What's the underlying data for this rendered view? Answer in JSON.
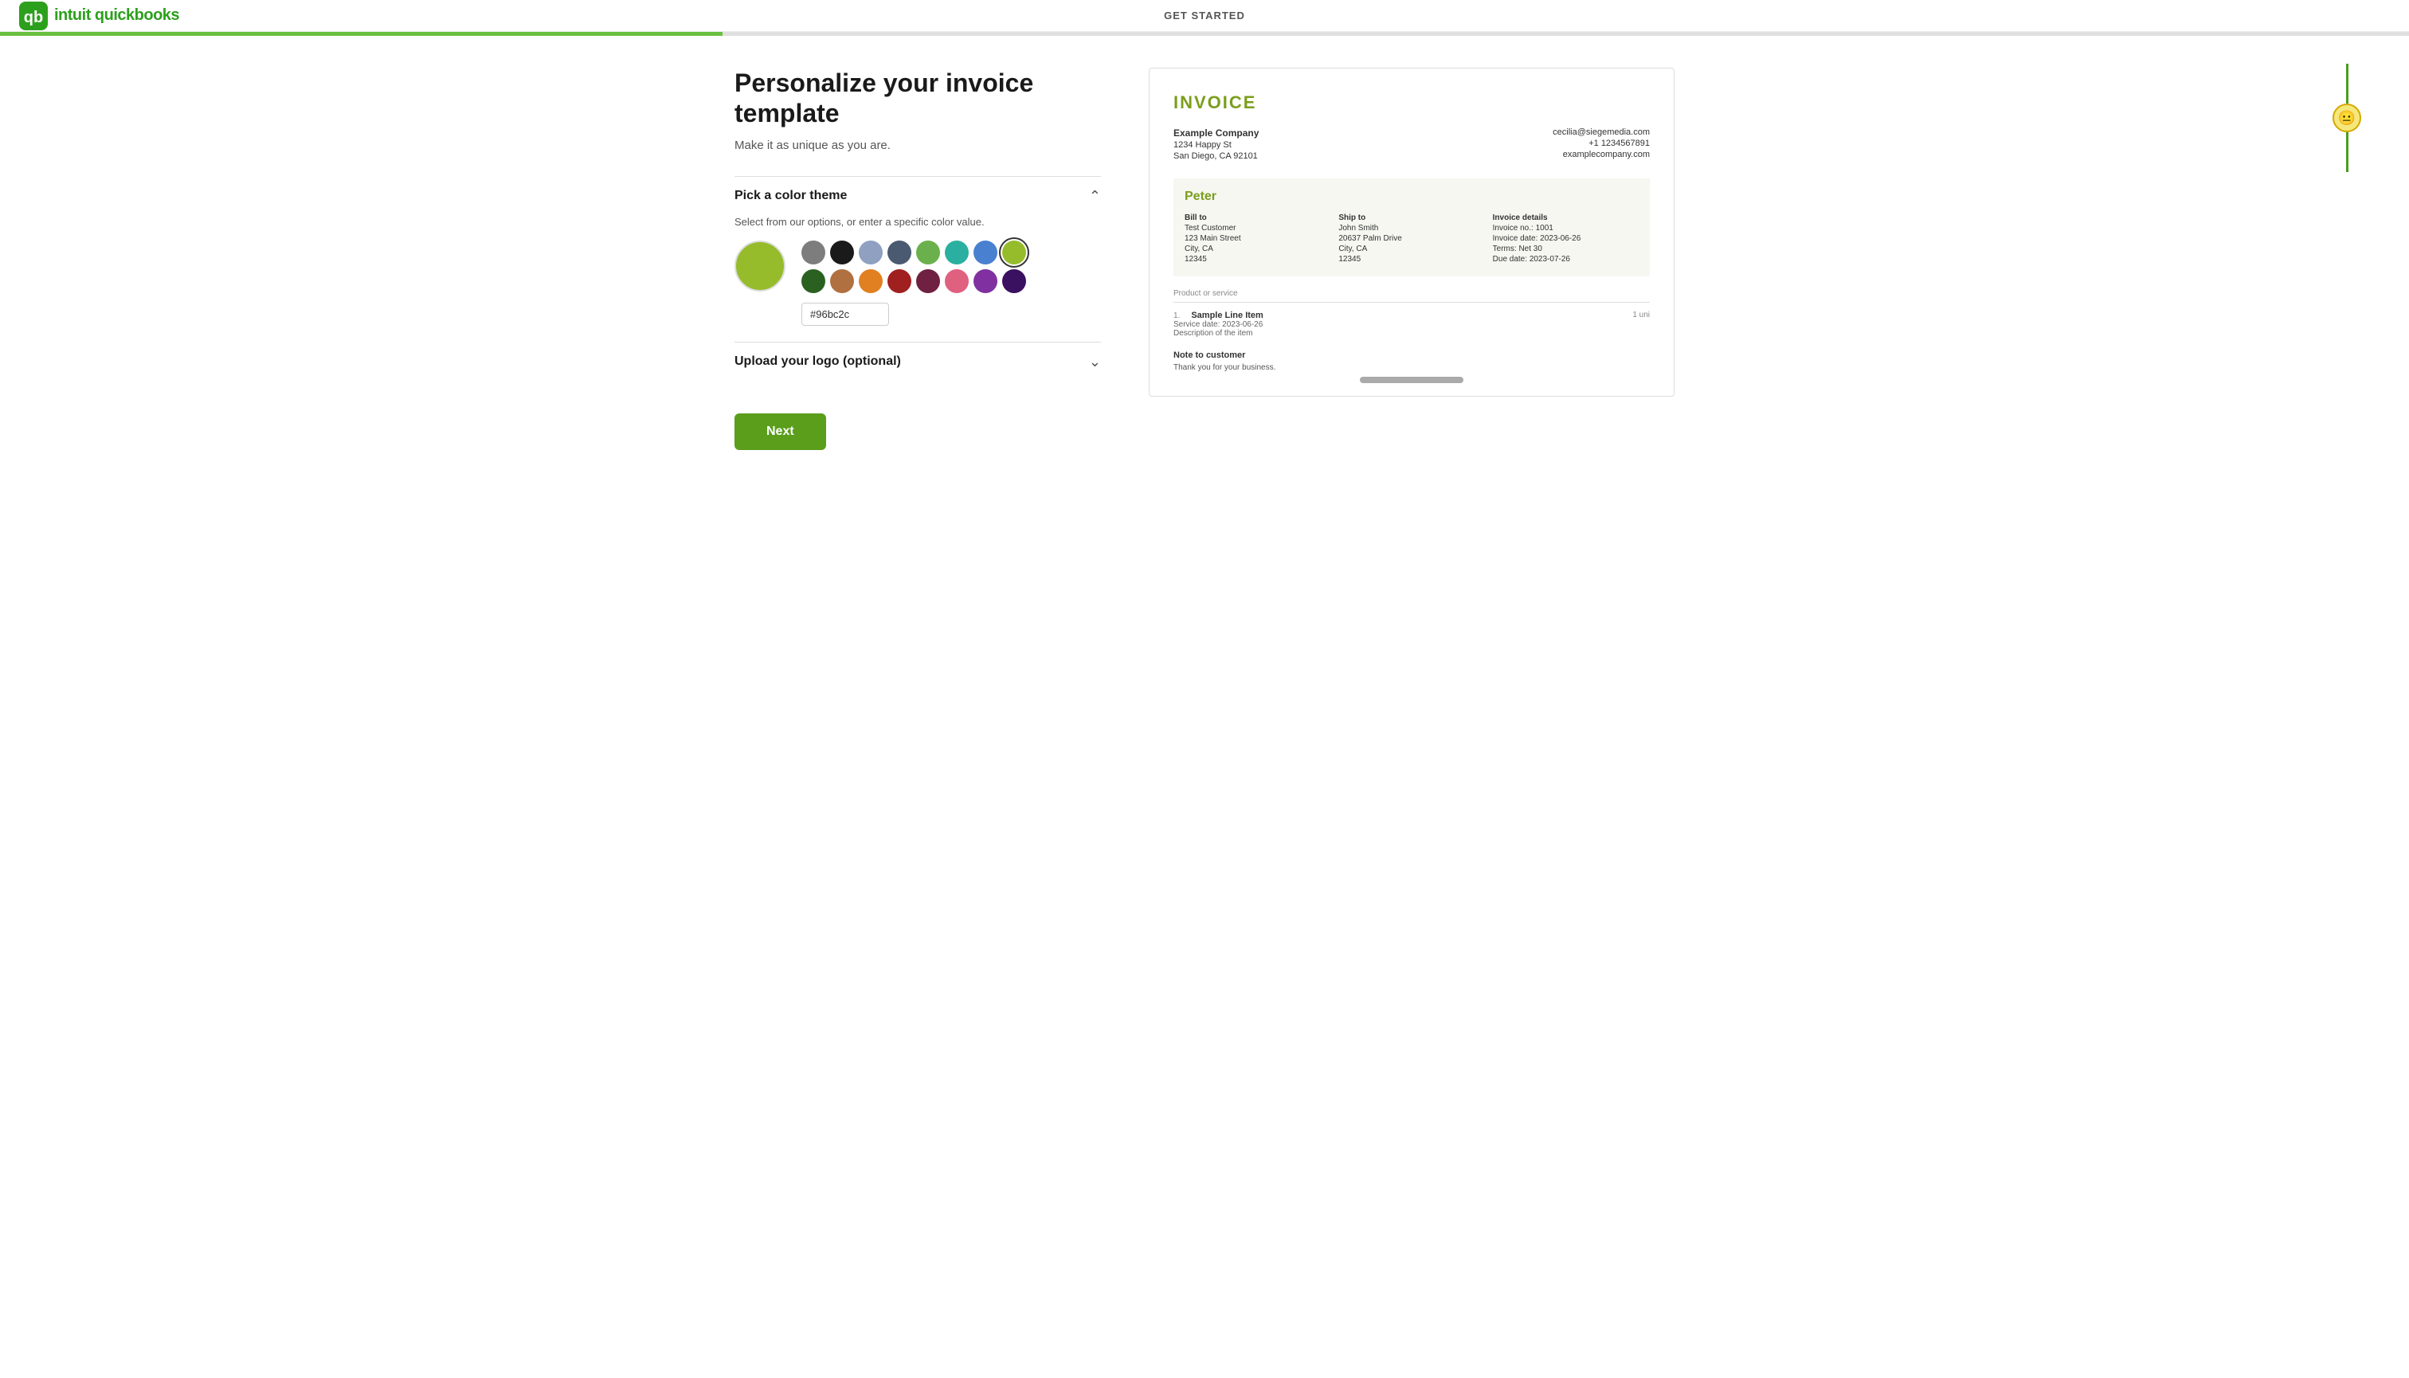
{
  "header": {
    "title": "GET STARTED",
    "logo_alt": "QuickBooks logo"
  },
  "progress": {
    "percent": 30
  },
  "page": {
    "title": "Personalize your invoice template",
    "subtitle": "Make it as unique as you are."
  },
  "color_section": {
    "label": "Pick a color theme",
    "instruction": "Select from our options, or enter a specific color value.",
    "selected_hex": "#96bc2c",
    "selected_color": "#96bc2c",
    "swatches": [
      {
        "color": "#7d7d7d",
        "name": "gray"
      },
      {
        "color": "#1a1a1a",
        "name": "black"
      },
      {
        "color": "#8fa0c0",
        "name": "light-blue-gray"
      },
      {
        "color": "#4a5a70",
        "name": "dark-blue-gray"
      },
      {
        "color": "#6ab04c",
        "name": "medium-green"
      },
      {
        "color": "#2ab0a0",
        "name": "teal"
      },
      {
        "color": "#4a80d0",
        "name": "blue"
      },
      {
        "color": "#96bc2c",
        "name": "yellow-green"
      },
      {
        "color": "#2a6020",
        "name": "dark-green"
      },
      {
        "color": "#b07040",
        "name": "brown"
      },
      {
        "color": "#e08020",
        "name": "orange"
      },
      {
        "color": "#a02020",
        "name": "dark-red"
      },
      {
        "color": "#702040",
        "name": "maroon"
      },
      {
        "color": "#e06080",
        "name": "pink"
      },
      {
        "color": "#8030a0",
        "name": "purple"
      },
      {
        "color": "#3a1060",
        "name": "dark-purple"
      }
    ]
  },
  "logo_section": {
    "label": "Upload your logo (optional)"
  },
  "next_button": {
    "label": "Next"
  },
  "invoice_preview": {
    "title": "INVOICE",
    "company": {
      "name": "Example Company",
      "address1": "1234 Happy St",
      "address2": "San Diego, CA 92101"
    },
    "contact": {
      "email": "cecilia@siegemedia.com",
      "phone": "+1 1234567891",
      "website": "examplecompany.com"
    },
    "customer_name": "Peter",
    "bill_to": {
      "title": "Bill to",
      "name": "Test Customer",
      "address1": "123 Main Street",
      "address2": "City, CA",
      "zip": "12345"
    },
    "ship_to": {
      "title": "Ship to",
      "name": "John Smith",
      "address1": "20637 Palm Drive",
      "address2": "City, CA",
      "zip": "12345"
    },
    "invoice_details": {
      "title": "Invoice details",
      "number_label": "Invoice no.:",
      "number": "1001",
      "date_label": "Invoice date:",
      "date": "2023-06-26",
      "terms_label": "Terms:",
      "terms": "Net 30",
      "due_label": "Due date:",
      "due": "2023-07-26"
    },
    "line_items_header": "Product or service",
    "line_items": [
      {
        "num": "1.",
        "name": "Sample Line Item",
        "service_date_label": "Service date:",
        "service_date": "2023-06-26",
        "description": "Description of the item",
        "qty": "1 uni"
      }
    ],
    "note": {
      "title": "Note to customer",
      "text": "Thank you for your business."
    }
  }
}
